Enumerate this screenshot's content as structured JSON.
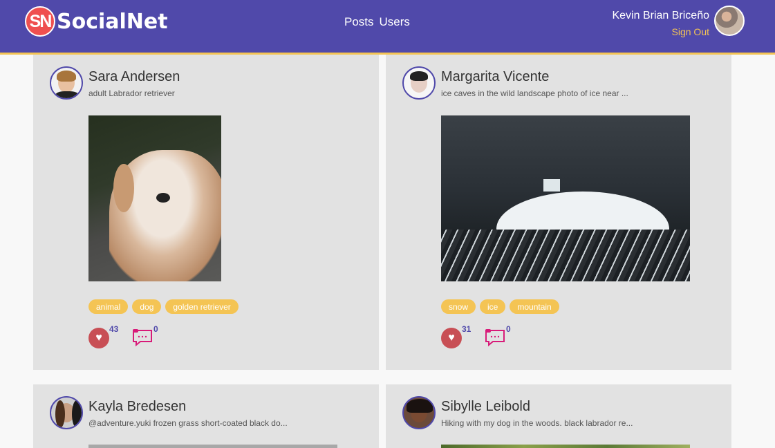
{
  "app": {
    "logo_badge": "SN",
    "logo_text": "SocialNet"
  },
  "nav": {
    "links": [
      "Posts",
      "Users"
    ]
  },
  "user": {
    "name": "Kevin Brian Briceño",
    "signout": "Sign Out"
  },
  "posts": [
    {
      "author": "Sara Andersen",
      "caption": "adult Labrador retriever",
      "tags": [
        "animal",
        "dog",
        "golden retriever"
      ],
      "likes": "43",
      "comments": "0"
    },
    {
      "author": "Margarita Vicente",
      "caption": "ice caves in the wild landscape photo of ice near ...",
      "tags": [
        "snow",
        "ice",
        "mountain"
      ],
      "likes": "31",
      "comments": "0"
    },
    {
      "author": "Kayla Bredesen",
      "caption": "@adventure.yuki frozen grass short-coated black do..."
    },
    {
      "author": "Sibylle Leibold",
      "caption": "Hiking with my dog in the woods. black labrador re..."
    }
  ],
  "icons": {
    "like": "heart-icon",
    "comment": "comment-icon"
  },
  "colors": {
    "navbar": "#5049aa",
    "accent": "#f4c454",
    "logo": "#ef5050",
    "like": "#c84f55",
    "comment": "#d81b79"
  }
}
